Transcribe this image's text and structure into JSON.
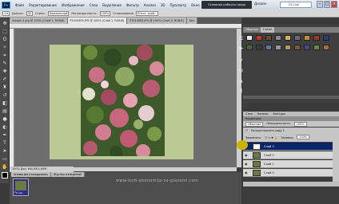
{
  "app": {
    "logo": "Ps"
  },
  "menu": [
    "Файл",
    "Редактирование",
    "Изображение",
    "Слои",
    "Выделение",
    "Фильтр",
    "Анализ",
    "3D",
    "Просмотр",
    "Окно",
    "Справка"
  ],
  "workspace": {
    "active": "Основная рабочая среда",
    "second": "Дизайн",
    "search": "CS Live"
  },
  "options": {
    "style_label": "Стиль:",
    "style_value": "Нормальный",
    "width_label": "Ширина:",
    "height_label": "Высота:",
    "opacity_label": "Непрозрачность:",
    "opacity_value": "100%",
    "mode": "Сглаживание",
    "refine": "Уточн. край...",
    "tolerance": "Допуск:",
    "tolerance_value": "32"
  },
  "doc_tabs": [
    "mosaic-2.jpg @ 100% (Слой 1, RGB/8)",
    "P1010959.JPG @ 100% (Слой 1, RGB/8)",
    "P1010083.JPG @ 100% (Слой 3, RGB/8)",
    "Без"
  ],
  "status": {
    "zoom": "100%",
    "doc": "Док: 640,6K/1,69M"
  },
  "animation": {
    "tabs": [
      "Анимация (покадровая)",
      "Журнал измерений"
    ],
    "frame_number": "1",
    "frame_delay": "0 сек."
  },
  "watermark": "www-kom-ekonomija-za-glazami.com",
  "styles_panel": {
    "tabs": [
      "Образцы",
      "Стили"
    ]
  },
  "layers_panel": {
    "tabs": [
      "Слои",
      "Каналы",
      "Контуры"
    ],
    "header": "Коррекция",
    "blend": "Обычные",
    "opacity_label": "Непрозрачность:",
    "opacity_value": "100%",
    "lock_label": "Закрепить:",
    "propagate": "Распространить кадр 1",
    "fill_label": "Заливка:",
    "fill_value": "100%",
    "layers": [
      {
        "name": "Слой 3"
      },
      {
        "name": "Слой 2"
      },
      {
        "name": "Слой 1"
      },
      {
        "name": "Слой 0"
      }
    ]
  }
}
